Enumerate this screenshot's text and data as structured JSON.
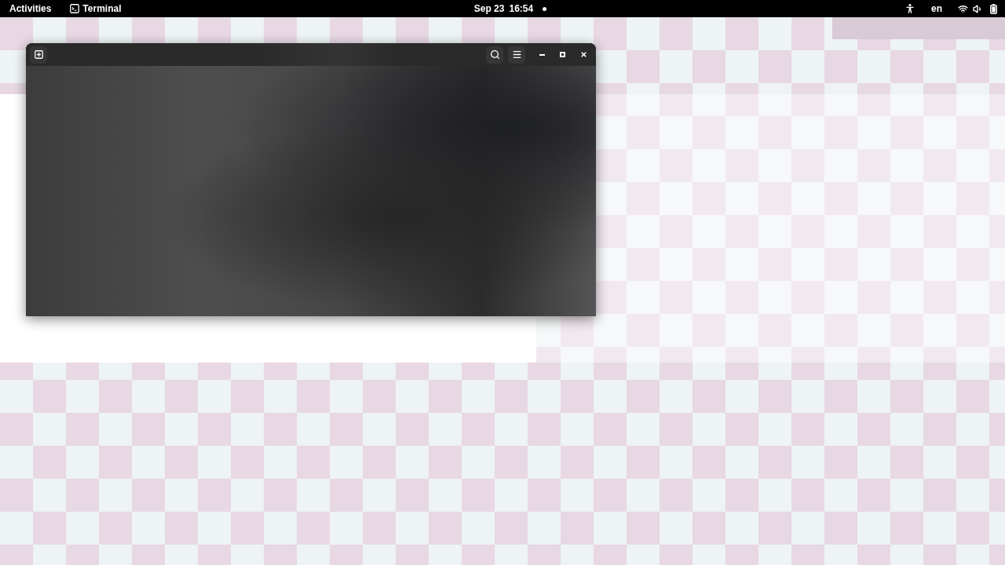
{
  "top_bar": {
    "activities": "Activities",
    "app_menu": {
      "label": "Terminal"
    },
    "clock": {
      "date": "Sep 23",
      "time": "16:54"
    },
    "notifications": true,
    "keyboard_layout": "en"
  }
}
